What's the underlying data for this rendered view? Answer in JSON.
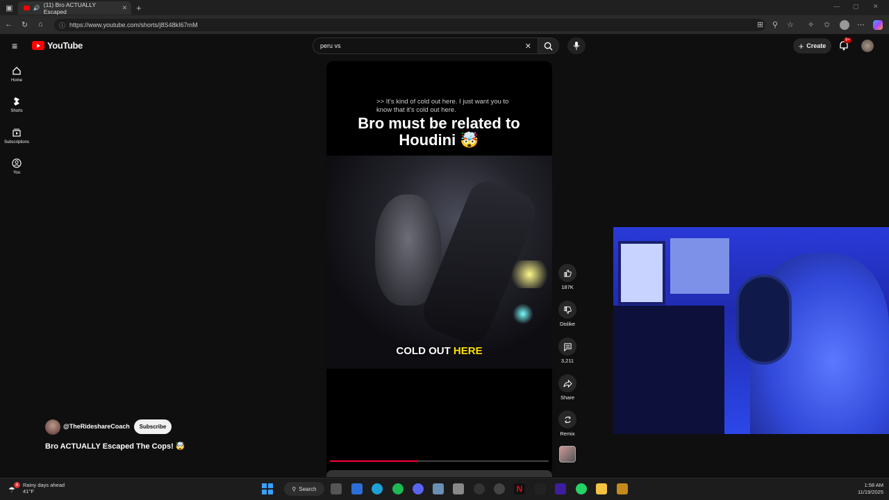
{
  "browser": {
    "tab_title": "(11) Bro ACTUALLY Escaped",
    "url": "https://www.youtube.com/shorts/j8S48kI67mM"
  },
  "youtube": {
    "logo_text": "YouTube",
    "search_value": "peru vs",
    "create_label": "Create",
    "notification_count": "9+"
  },
  "sidebar": {
    "items": [
      {
        "label": "Home",
        "icon": "home-icon"
      },
      {
        "label": "Shorts",
        "icon": "shorts-icon"
      },
      {
        "label": "Subscriptions",
        "icon": "subscriptions-icon"
      },
      {
        "label": "You",
        "icon": "you-icon"
      }
    ]
  },
  "video": {
    "caption_top": ">> It's kind of cold out here. I just want you to know that it's cold out here.",
    "title_overlay": "Bro must be related to Houdini 🤯",
    "subtitle_plain": "COLD OUT ",
    "subtitle_highlight": "HERE",
    "progress": 0.4
  },
  "actions": {
    "like_count": "187K",
    "dislike_label": "Dislike",
    "comment_count": "3,211",
    "share_label": "Share",
    "remix_label": "Remix"
  },
  "channel": {
    "name": "@TheRideshareCoach",
    "subscribe_label": "Subscribe",
    "video_title": "Bro ACTUALLY Escaped The Cops! 🤯"
  },
  "taskbar": {
    "weather_badge": "6",
    "weather_text": "Rainy days ahead",
    "weather_temp": "41°F",
    "search_label": "Search",
    "time": "1:58 AM",
    "date": "11/19/2025"
  },
  "colors": {
    "youtube_red": "#ff0000",
    "progress_red": "#ff0033",
    "subtitle_highlight": "#ffe000"
  }
}
